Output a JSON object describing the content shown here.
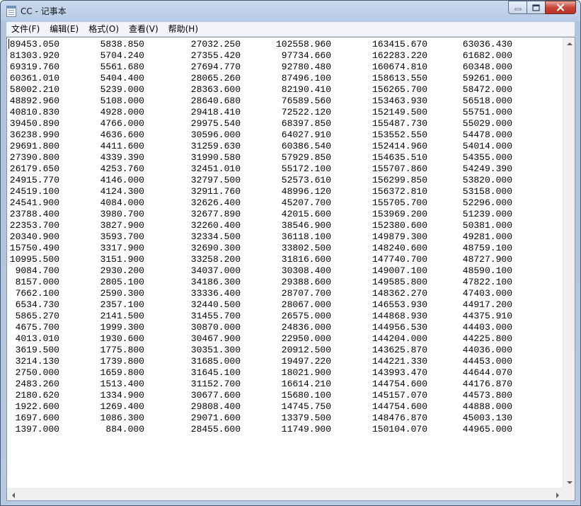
{
  "window": {
    "title": "CC - 记事本",
    "icon": "notepad-icon",
    "controls": [
      "minimize-icon",
      "maximize-icon",
      "close-icon"
    ],
    "close_color": "#c8463a"
  },
  "menu": [
    "文件(F)",
    "编辑(E)",
    "格式(O)",
    "查看(V)",
    "帮助(H)"
  ],
  "document": {
    "rows": [
      [
        "89453.050",
        "5838.850",
        "27032.250",
        "102558.960",
        "163415.670",
        "63036.430"
      ],
      [
        "81303.920",
        "5704.240",
        "27355.420",
        "97734.660",
        "162283.220",
        "61682.000"
      ],
      [
        "69319.760",
        "5561.680",
        "27694.770",
        "92780.480",
        "160674.810",
        "60348.000"
      ],
      [
        "60361.010",
        "5404.400",
        "28065.260",
        "87496.100",
        "158613.550",
        "59261.000"
      ],
      [
        "58002.210",
        "5239.000",
        "28363.600",
        "82190.410",
        "156265.700",
        "58472.000"
      ],
      [
        "48892.960",
        "5108.000",
        "28640.680",
        "76589.560",
        "153463.930",
        "56518.000"
      ],
      [
        "40810.830",
        "4928.000",
        "29418.410",
        "72522.120",
        "152149.500",
        "55751.000"
      ],
      [
        "39450.890",
        "4766.000",
        "29975.540",
        "68397.850",
        "155487.730",
        "55029.000"
      ],
      [
        "36238.990",
        "4636.600",
        "30596.000",
        "64027.910",
        "153552.550",
        "54478.000"
      ],
      [
        "29691.800",
        "4411.600",
        "31259.630",
        "60386.540",
        "152414.960",
        "54014.000"
      ],
      [
        "27390.800",
        "4339.390",
        "31990.580",
        "57929.850",
        "154635.510",
        "54355.000"
      ],
      [
        "26179.650",
        "4253.760",
        "32451.010",
        "55172.100",
        "155707.860",
        "54249.390"
      ],
      [
        "24915.770",
        "4146.000",
        "32797.500",
        "52573.610",
        "156299.850",
        "53820.000"
      ],
      [
        "24519.100",
        "4124.300",
        "32911.760",
        "48996.120",
        "156372.810",
        "53158.000"
      ],
      [
        "24541.900",
        "4084.000",
        "32626.400",
        "45207.700",
        "155705.700",
        "52296.000"
      ],
      [
        "23788.400",
        "3980.700",
        "32677.890",
        "42015.600",
        "153969.200",
        "51239.000"
      ],
      [
        "22353.700",
        "3827.900",
        "32260.400",
        "38546.900",
        "152380.600",
        "50381.000"
      ],
      [
        "20340.900",
        "3593.700",
        "32334.500",
        "36118.100",
        "149879.300",
        "49281.000"
      ],
      [
        "15750.490",
        "3317.900",
        "32690.300",
        "33802.500",
        "148240.600",
        "48759.100"
      ],
      [
        "10995.500",
        "3151.900",
        "33258.200",
        "31816.600",
        "147740.700",
        "48727.900"
      ],
      [
        "9084.700",
        "2930.200",
        "34037.000",
        "30308.400",
        "149007.100",
        "48590.100"
      ],
      [
        "8157.000",
        "2805.100",
        "34186.300",
        "29388.600",
        "149585.800",
        "47822.100"
      ],
      [
        "7662.100",
        "2590.300",
        "33336.400",
        "28707.700",
        "148362.270",
        "47403.000"
      ],
      [
        "6534.730",
        "2357.100",
        "32440.500",
        "28067.000",
        "146553.930",
        "44917.200"
      ],
      [
        "5865.270",
        "2141.500",
        "31455.700",
        "26575.000",
        "144868.930",
        "44375.910"
      ],
      [
        "4675.700",
        "1999.300",
        "30870.000",
        "24836.000",
        "144956.530",
        "44403.000"
      ],
      [
        "4013.010",
        "1930.600",
        "30467.900",
        "22950.000",
        "144204.000",
        "44225.800"
      ],
      [
        "3619.500",
        "1775.800",
        "30351.300",
        "20912.500",
        "143625.870",
        "44036.000"
      ],
      [
        "3214.130",
        "1739.800",
        "31685.000",
        "19497.220",
        "144221.330",
        "44453.000"
      ],
      [
        "2750.000",
        "1659.800",
        "31645.100",
        "18021.900",
        "143993.470",
        "44644.070"
      ],
      [
        "2483.260",
        "1513.400",
        "31152.700",
        "16614.210",
        "144754.600",
        "44176.870"
      ],
      [
        "2180.620",
        "1334.900",
        "30677.600",
        "15680.100",
        "145157.070",
        "44573.800"
      ],
      [
        "1922.600",
        "1269.400",
        "29808.400",
        "14745.750",
        "144754.600",
        "44888.000"
      ],
      [
        "1697.600",
        "1086.300",
        "29071.600",
        "13379.500",
        "148476.870",
        "45003.130"
      ],
      [
        "1397.000",
        "884.000",
        "28455.600",
        "11749.900",
        "150104.070",
        "44965.000"
      ]
    ]
  },
  "scrollbars": {
    "vertical": [
      "scroll-up-icon",
      "scroll-down-icon"
    ],
    "horizontal": [
      "scroll-left-icon",
      "scroll-right-icon"
    ]
  }
}
